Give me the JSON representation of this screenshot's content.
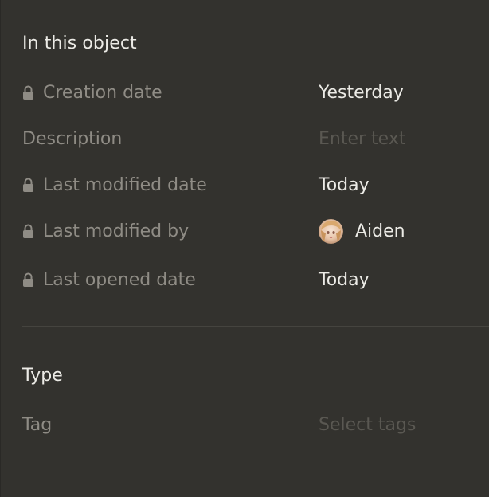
{
  "sections": {
    "object": {
      "title": "In this object",
      "rows": [
        {
          "label": "Creation date",
          "value": "Yesterday",
          "locked": true
        },
        {
          "label": "Description",
          "placeholder": "Enter text",
          "locked": false
        },
        {
          "label": "Last modified date",
          "value": "Today",
          "locked": true
        },
        {
          "label": "Last modified by",
          "value": "Aiden",
          "locked": true
        },
        {
          "label": "Last opened date",
          "value": "Today",
          "locked": true
        }
      ]
    },
    "type": {
      "title": "Type",
      "rows": [
        {
          "label": "Tag",
          "placeholder": "Select tags"
        }
      ]
    }
  },
  "colors": {
    "background": "#33322e",
    "label": "#8f8c85",
    "value": "#ecebe6",
    "placeholder": "#5a5852",
    "divider": "#45443f"
  }
}
